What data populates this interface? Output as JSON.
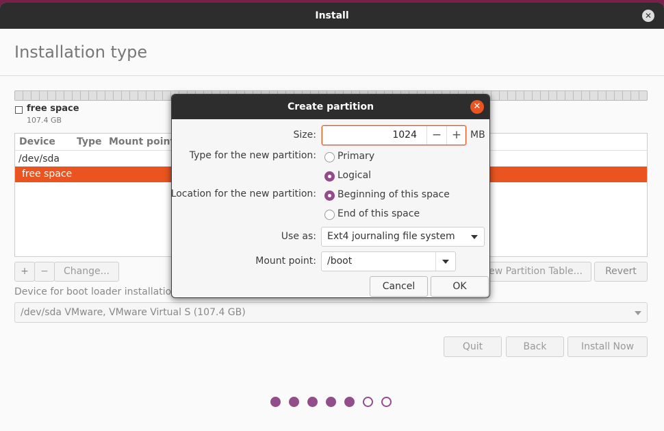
{
  "window": {
    "title": "Install",
    "close_glyph": "✕"
  },
  "page": {
    "title": "Installation type"
  },
  "legend": {
    "name": "free space",
    "size": "107.4 GB"
  },
  "partition_table": {
    "columns": [
      "Device",
      "Type",
      "Mount point"
    ],
    "rows": [
      "/dev/sda",
      "free space"
    ]
  },
  "toolbar": {
    "add_glyph": "+",
    "remove_glyph": "−",
    "change_label": "Change...",
    "new_table_label": "New Partition Table...",
    "revert_label": "Revert"
  },
  "bootloader": {
    "label": "Device for boot loader installation:",
    "value": "/dev/sda VMware, VMware Virtual S (107.4 GB)"
  },
  "nav": {
    "quit": "Quit",
    "back": "Back",
    "install": "Install Now"
  },
  "progress": {
    "total": 7,
    "done": 5
  },
  "dialog": {
    "title": "Create partition",
    "close_glyph": "✕",
    "size_label": "Size:",
    "size_value": "1024",
    "minus_glyph": "−",
    "plus_glyph": "+",
    "size_unit": "MB",
    "type_label": "Type for the new partition:",
    "type_primary": "Primary",
    "type_logical": "Logical",
    "location_label": "Location for the new partition:",
    "location_beginning": "Beginning of this space",
    "location_end": "End of this space",
    "use_as_label": "Use as:",
    "use_as_value": "Ext4 journaling file system",
    "mount_label": "Mount point:",
    "mount_value": "/boot",
    "cancel": "Cancel",
    "ok": "OK"
  },
  "colors": {
    "accent": "#e95420",
    "aubergine": "#924d8b",
    "titlebar": "#2d2d2d"
  }
}
